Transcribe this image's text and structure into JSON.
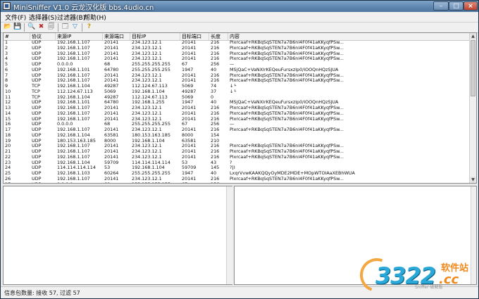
{
  "window": {
    "title": "MiniSniffer V1.0 云龙汉化版 bbs.4udio.cn"
  },
  "titlebar_buttons": {
    "min": "–",
    "max": "□",
    "close": "×"
  },
  "menu": [
    {
      "label": "文件(F)"
    },
    {
      "label": "选择器(S)"
    },
    {
      "label": "过滤器(B)"
    },
    {
      "label": "帮助(H)"
    }
  ],
  "toolbar": [
    {
      "icon": "open-folder-icon",
      "glyph": "📂"
    },
    {
      "icon": "save-icon",
      "glyph": "💾"
    },
    {
      "icon": "search-icon",
      "glyph": "🔍"
    },
    {
      "icon": "stop-capture-icon",
      "glyph": "✖"
    },
    {
      "icon": "clear-icon",
      "glyph": "🗐"
    },
    {
      "icon": "adapter-icon",
      "glyph": "🗔"
    },
    {
      "icon": "filter-icon",
      "glyph": "▽"
    },
    {
      "icon": "help-icon",
      "glyph": "?"
    }
  ],
  "table": {
    "columns": [
      "#",
      "协议",
      "来源IP",
      "来源端口",
      "目标IP",
      "目标端口",
      "长度",
      "内容"
    ],
    "rows": [
      [
        "1",
        "UDP",
        "192.168.1.107",
        "20141",
        "234.123.12.1",
        "20141",
        "216",
        "Plxrcaaf+RKBqSqSTEN7a7B6nl4F0f41aKKyqfPSw..."
      ],
      [
        "2",
        "UDP",
        "192.168.1.107",
        "20141",
        "234.123.12.1",
        "20141",
        "216",
        "Plxrcaaf+RKBqSqSTEN7a7B6nl4F0f41aKKyqfPSw..."
      ],
      [
        "3",
        "UDP",
        "192.168.1.107",
        "20141",
        "234.123.12.1",
        "20141",
        "216",
        "Plxrcaaf+RKBqSqSTEN7a7B6nl4F0f41aKKyqfPSw..."
      ],
      [
        "4",
        "UDP",
        "192.168.1.107",
        "20141",
        "234.123.12.1",
        "20141",
        "216",
        "Plxrcaaf+RKBqSqSTEN7a7B6nl4F0f41aKKyqfPSw..."
      ],
      [
        "5",
        "UDP",
        "0.0.0.0",
        "68",
        "255.255.255.255",
        "67",
        "256",
        "—"
      ],
      [
        "6",
        "UDP",
        "192.168.1.101",
        "64780",
        "255.255.255.255",
        "1947",
        "40",
        "MSjQaC+VaNXIrKEQeuFursxzlp0/iOOQnHQzSJUA"
      ],
      [
        "7",
        "UDP",
        "192.168.1.107",
        "20141",
        "234.123.12.1",
        "20141",
        "216",
        "Plxrcaaf+RKBqSqSTEN7a7B6nl4F0f41aKKyqfPSw..."
      ],
      [
        "8",
        "UDP",
        "192.168.1.107",
        "20141",
        "234.123.12.1",
        "20141",
        "216",
        "Plxrcaaf+RKBqSqSTEN7a7B6nl4F0f41aKKyqfPSw..."
      ],
      [
        "9",
        "TCP",
        "192.168.1.104",
        "49287",
        "112.124.67.113",
        "5069",
        "74",
        "↓└"
      ],
      [
        "10",
        "TCP",
        "112.124.67.113",
        "5069",
        "192.168.1.104",
        "49287",
        "37",
        "↓└"
      ],
      [
        "11",
        "TCP",
        "192.168.1.104",
        "49287",
        "112.124.67.113",
        "5069",
        "0",
        ""
      ],
      [
        "12",
        "UDP",
        "192.168.1.101",
        "64780",
        "192.168.1.255",
        "1947",
        "40",
        "MSjQaC+VaNXIrKEQeuFursxzlp0/iOOQnHQzSJUA"
      ],
      [
        "13",
        "UDP",
        "192.168.1.107",
        "20141",
        "234.123.12.1",
        "20141",
        "216",
        "Plxrcaaf+RKBqSqSTEN7a7B6nl4F0f41aKKyqfPSw..."
      ],
      [
        "14",
        "UDP",
        "192.168.1.107",
        "20141",
        "234.123.12.1",
        "20141",
        "216",
        "Plxrcaaf+RKBqSqSTEN7a7B6nl4F0f41aKKyqfPSw..."
      ],
      [
        "15",
        "UDP",
        "192.168.1.107",
        "20141",
        "234.123.12.1",
        "20141",
        "216",
        "Plxrcaaf+RKBqSqSTEN7a7B6nl4F0f41aKKyqfPSw..."
      ],
      [
        "16",
        "UDP",
        "0.0.0.0",
        "68",
        "255.255.255.255",
        "67",
        "256",
        "—"
      ],
      [
        "17",
        "UDP",
        "192.168.1.107",
        "20141",
        "234.123.12.1",
        "20141",
        "216",
        "Plxrcaaf+RKBqSqSTEN7a7B6nl4F0f41aKKyqfPSw..."
      ],
      [
        "18",
        "UDP",
        "192.168.1.104",
        "63581",
        "180.153.163.185",
        "8000",
        "154",
        ""
      ],
      [
        "19",
        "UDP",
        "180.153.163.185",
        "8000",
        "192.168.1.104",
        "63581",
        "210",
        ""
      ],
      [
        "20",
        "UDP",
        "192.168.1.107",
        "20141",
        "234.123.12.1",
        "20141",
        "216",
        "Plxrcaaf+RKBqSqSTEN7a7B6nl4F0f41aKKyqfPSw..."
      ],
      [
        "21",
        "UDP",
        "192.168.1.107",
        "20141",
        "234.123.12.1",
        "20141",
        "216",
        "Plxrcaaf+RKBqSqSTEN7a7B6nl4F0f41aKKyqfPSw..."
      ],
      [
        "22",
        "UDP",
        "192.168.1.107",
        "20141",
        "234.123.12.1",
        "20141",
        "216",
        "Plxrcaaf+RKBqSqSTEN7a7B6nl4F0f41aKKyqfPSw..."
      ],
      [
        "23",
        "UDP",
        "192.168.1.104",
        "59709",
        "114.114.114.114",
        "53",
        "43",
        "?"
      ],
      [
        "24",
        "UDP",
        "114.114.114.114",
        "53",
        "192.168.1.104",
        "59709",
        "145",
        "?[I"
      ],
      [
        "25",
        "UDP",
        "192.168.1.103",
        "60264",
        "255.255.255.255",
        "1947",
        "40",
        "LxqrVvwKAAKQQyOyMDE2MDE+MOpWTOIAaXEBhWUA"
      ],
      [
        "26",
        "UDP",
        "192.168.1.107",
        "20141",
        "234.123.12.1",
        "20141",
        "216",
        "Plxrcaaf+RKBqSqSTEN7a7B6nl4F0f41aKKyqfPSw..."
      ],
      [
        "27",
        "UDP",
        "0.0.0.0",
        "68",
        "255.255.255.255",
        "67",
        "256",
        "—"
      ]
    ]
  },
  "scrollbar": {
    "up": "▲",
    "down": "▼"
  },
  "status": {
    "text": "信息包数量: 接收 57, 过滤 57"
  },
  "watermark": {
    "number": "3322",
    "cn": "软件站",
    "domain": ".cc",
    "small": "Sniffer 破解版"
  }
}
